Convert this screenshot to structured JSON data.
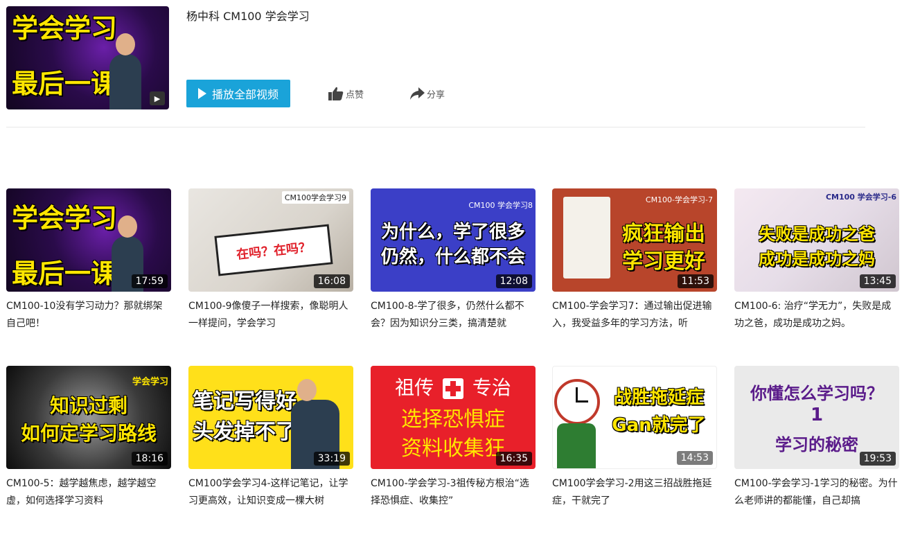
{
  "playlist": {
    "title": "杨中科 CM100 学会学习",
    "cover_line1": "学会学习",
    "cover_line2": "最后一课",
    "play_all_label": "播放全部视频",
    "like_label": "点赞",
    "share_label": "分享"
  },
  "colors": {
    "accent": "#1aa3d9",
    "thumb_yellow_text": "#ffe600"
  },
  "videos": [
    {
      "title": "CM100-10没有学习动力？那就绑架自己吧！",
      "duration": "17:59",
      "thumb_text_1": "学会学习",
      "thumb_text_2": "最后一课",
      "thumb_tag": ""
    },
    {
      "title": "CM100-9像傻子一样搜索，像聪明人一样提问，学会学习",
      "duration": "16:08",
      "thumb_text_1": "在吗？在吗？",
      "thumb_text_2": "",
      "thumb_tag": "CM100学会学习9"
    },
    {
      "title": "CM100-8-学了很多，仍然什么都不会？因为知识分三类，搞清楚就",
      "duration": "12:08",
      "thumb_text_1": "为什么，学了很多",
      "thumb_text_2": "仍然，什么都不会",
      "thumb_tag": "CM100 学会学习8"
    },
    {
      "title": "CM100-学会学习7：通过输出促进输入，我受益多年的学习方法，听",
      "duration": "11:53",
      "thumb_text_1": "疯狂输出",
      "thumb_text_2": "学习更好",
      "thumb_tag": "CM100-学会学习-7"
    },
    {
      "title": "CM100-6: 治疗“学无力”，失败是成功之爸，成功是成功之妈。",
      "duration": "13:45",
      "thumb_text_1": "失败是成功之爸",
      "thumb_text_2": "成功是成功之妈",
      "thumb_tag": "CM100 学会学习-6"
    },
    {
      "title": "CM100-5：越学越焦虑，越学越空虚，如何选择学习资料",
      "duration": "18:16",
      "thumb_text_1": "知识过剩",
      "thumb_text_2": "如何定学习路线",
      "thumb_tag": "学会学习"
    },
    {
      "title": "CM100学会学习4-这样记笔记，让学习更高效，让知识变成一棵大树",
      "duration": "33:19",
      "thumb_text_1": "笔记写得好",
      "thumb_text_2": "头发掉不了",
      "thumb_tag": ""
    },
    {
      "title": "CM100-学会学习-3祖传秘方根治“选择恐惧症、收集控”",
      "duration": "16:35",
      "thumb_text_1": "祖传",
      "thumb_text_1b": "专治",
      "thumb_text_2": "选择恐惧症",
      "thumb_text_3": "资料收集狂",
      "thumb_tag": ""
    },
    {
      "title": "CM100学会学习-2用这三招战胜拖延症，干就完了",
      "duration": "14:53",
      "thumb_text_1": "战胜拖延症",
      "thumb_text_2": "Gan就完了",
      "thumb_tag": ""
    },
    {
      "title": "CM100-学会学习-1学习的秘密。为什么老师讲的都能懂，自己却搞",
      "duration": "19:53",
      "thumb_text_1": "你懂怎么学习吗？",
      "thumb_text_2": "1",
      "thumb_text_3": "学习的秘密",
      "thumb_tag": ""
    }
  ]
}
